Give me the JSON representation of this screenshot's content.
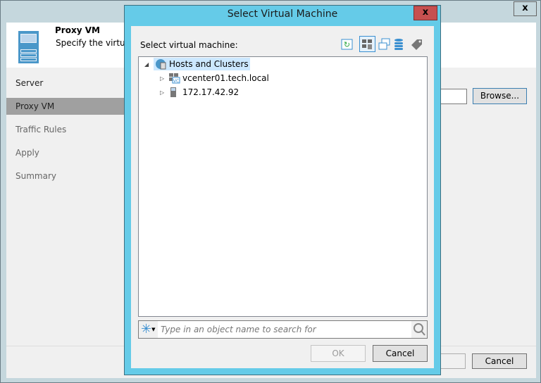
{
  "wizard": {
    "header_title": "Proxy VM",
    "header_subtitle": "Specify the virtual",
    "steps": [
      "Server",
      "Proxy VM",
      "Traffic Rules",
      "Apply",
      "Summary"
    ],
    "selected_step": "Proxy VM",
    "browse_label": "Browse...",
    "cancel_label": "Cancel",
    "close_label": "x"
  },
  "dialog": {
    "title": "Select Virtual Machine",
    "close_label": "x",
    "label": "Select virtual machine:",
    "toolbar": [
      "refresh-icon",
      "hosts-and-clusters-view-icon",
      "vms-and-templates-view-icon",
      "datastores-view-icon",
      "tags-view-icon"
    ],
    "tree": {
      "root": "Hosts and Clusters",
      "children": [
        "vcenter01.tech.local",
        "172.17.42.92"
      ]
    },
    "search_placeholder": "Type in an object name to search for",
    "ok_label": "OK",
    "cancel_label": "Cancel"
  },
  "colors": {
    "accent": "#65cbe8",
    "selection": "#cce8ff",
    "close": "#c75050"
  }
}
